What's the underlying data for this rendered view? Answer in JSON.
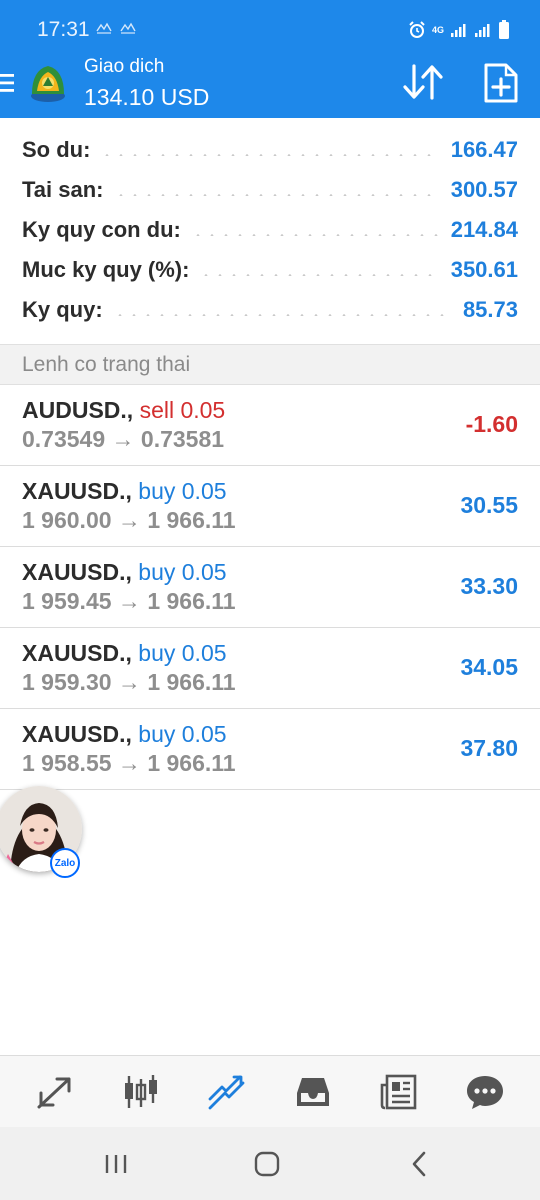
{
  "status_bar": {
    "time": "17:31",
    "network_label": "4G"
  },
  "app_bar": {
    "title": "Giao dich",
    "balance": "134.10 USD"
  },
  "account": {
    "rows": [
      {
        "label": "So du:",
        "value": "166.47"
      },
      {
        "label": "Tai san:",
        "value": "300.57"
      },
      {
        "label": "Ky quy con du:",
        "value": "214.84"
      },
      {
        "label": "Muc ky quy (%):",
        "value": "350.61"
      },
      {
        "label": "Ky quy:",
        "value": "85.73"
      }
    ]
  },
  "section": {
    "title": "Lenh co trang thai"
  },
  "positions": [
    {
      "symbol": "AUDUSD.,",
      "side": "sell 0.05",
      "open": "0.73549",
      "arrow": "→",
      "current": "0.73581",
      "profit": "-1.60"
    },
    {
      "symbol": "XAUUSD.,",
      "side": "buy 0.05",
      "open": "1 960.00",
      "arrow": "→",
      "current": "1 966.11",
      "profit": "30.55"
    },
    {
      "symbol": "XAUUSD.,",
      "side": "buy 0.05",
      "open": "1 959.45",
      "arrow": "→",
      "current": "1 966.11",
      "profit": "33.30"
    },
    {
      "symbol": "XAUUSD.,",
      "side": "buy 0.05",
      "open": "1 959.30",
      "arrow": "→",
      "current": "1 966.11",
      "profit": "34.05"
    },
    {
      "symbol": "XAUUSD.,",
      "side": "buy 0.05",
      "open": "1 958.55",
      "arrow": "→",
      "current": "1 966.11",
      "profit": "37.80"
    }
  ],
  "zalo": {
    "badge": "Zalo"
  },
  "toolbar": {
    "icons": [
      "quotes-icon",
      "chart-icon",
      "trade-icon",
      "history-icon",
      "news-icon",
      "chat-icon"
    ],
    "active": "trade-icon"
  },
  "colors": {
    "brand_blue": "#1e88ea",
    "value_blue": "#1e7fdc",
    "loss_red": "#d32f2f"
  }
}
